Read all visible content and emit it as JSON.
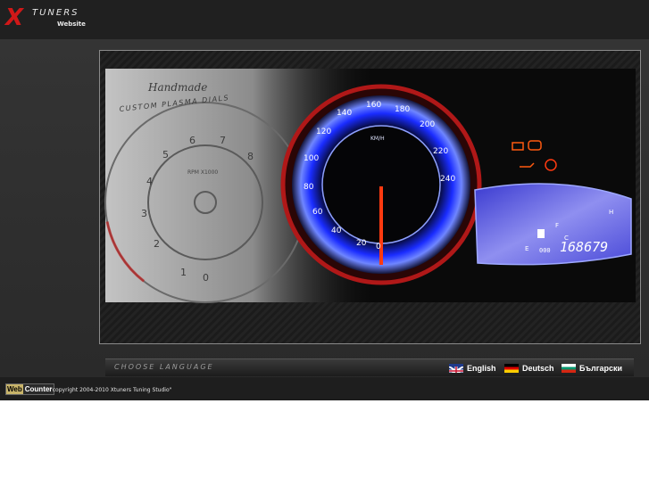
{
  "header": {
    "logo_mark": "X",
    "brand": "TUNERS",
    "subtitle": "Website"
  },
  "panel": {
    "handmade": "Handmade",
    "tagline": "CUSTOM PLASMA DIALS",
    "rpm_label": "RPM X1000",
    "tach_ticks": [
      "0",
      "1",
      "2",
      "3",
      "4",
      "5",
      "6",
      "7",
      "8"
    ],
    "speed_unit": "KM/H",
    "speed_ticks": [
      "0",
      "20",
      "40",
      "60",
      "80",
      "100",
      "120",
      "140",
      "160",
      "180",
      "200",
      "220",
      "240"
    ],
    "odometer": "168679",
    "trip": "000",
    "fuel_e": "E",
    "fuel_f": "F",
    "temp_c": "C",
    "temp_h": "H"
  },
  "language_bar": {
    "choose_label": "CHOOSE LANGUAGE",
    "languages": [
      "English",
      "Deutsch",
      "Български"
    ]
  },
  "footer": {
    "webcounter_web": "Web",
    "webcounter_counter": "Counter",
    "copyright": "\"copyright 2004-2010 Xtuners Tuning Studio\""
  },
  "colors": {
    "accent_red": "#d01818",
    "dial_blue": "#3a5cff",
    "warning_orange": "#ff5a10"
  }
}
